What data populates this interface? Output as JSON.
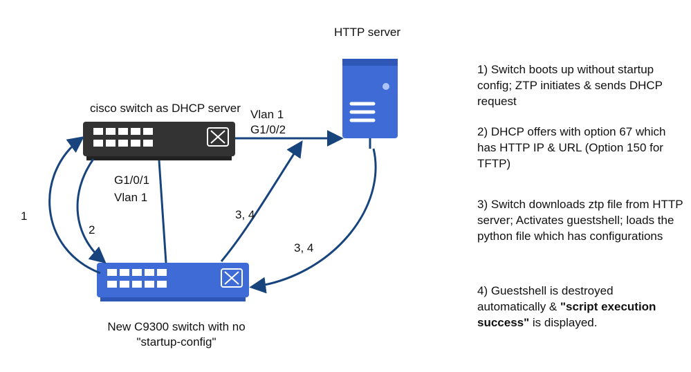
{
  "titles": {
    "http_server": "HTTP server",
    "dhcp_switch": "cisco switch as DHCP server",
    "new_switch_line1": "New C9300 switch with no",
    "new_switch_line2": "\"startup-config\""
  },
  "link_labels": {
    "vlan1_top": "Vlan 1",
    "g102": "G1/0/2",
    "g101": "G1/0/1",
    "vlan1_left": "Vlan 1"
  },
  "flow_labels": {
    "n1": "1",
    "n2": "2",
    "n34a": "3, 4",
    "n34b": "3, 4"
  },
  "steps": {
    "s1": "1) Switch boots up without startup config; ZTP initiates & sends DHCP request",
    "s2": "2) DHCP offers with option 67 which has HTTP IP & URL (Option 150 for TFTP)",
    "s3": "3) Switch downloads ztp file from HTTP server; Activates guestshell; loads the python file which has configurations",
    "s4a": "4) Guestshell is destroyed automatically & ",
    "s4b": "\"script execution success\"",
    "s4c": " is displayed."
  },
  "colors": {
    "switch_dark": "#3b3b3b",
    "switch_blue": "#3e6bd6",
    "server_blue": "#3e6bd6",
    "arrow": "#18447e"
  }
}
